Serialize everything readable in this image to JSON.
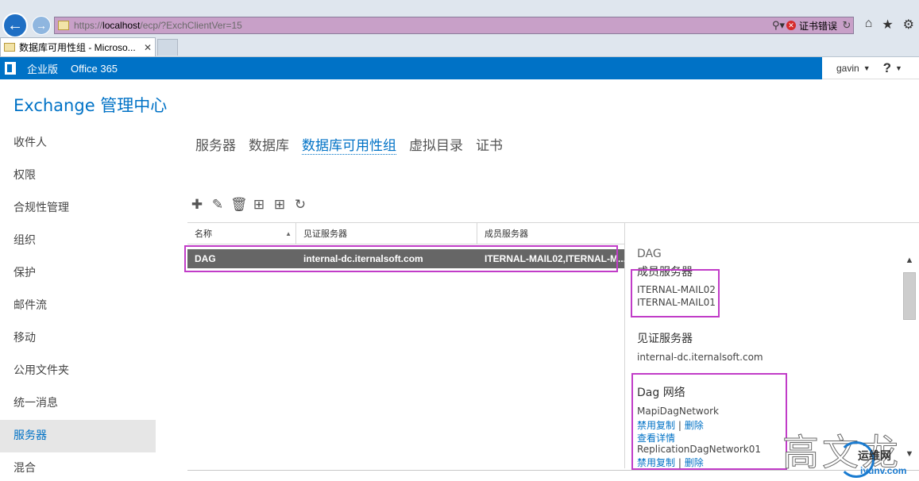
{
  "browser": {
    "url_prefix": "https://",
    "url_host": "localhost",
    "url_path": "/ecp/?ExchClientVer=15",
    "search_icon": "search-icon",
    "cert_error": "证书错误",
    "tab_label": "数据库可用性组 - Microso...",
    "tab_close": "✕"
  },
  "app_bar": {
    "edition": "企业版",
    "office365": "Office 365",
    "user": "gavin",
    "help": "?"
  },
  "page_title": "Exchange 管理中心",
  "nav": {
    "items": [
      "收件人",
      "权限",
      "合规性管理",
      "组织",
      "保护",
      "邮件流",
      "移动",
      "公用文件夹",
      "统一消息",
      "服务器",
      "混合"
    ],
    "active_index": 9
  },
  "sub_tabs": {
    "items": [
      "服务器",
      "数据库",
      "数据库可用性组",
      "虚拟目录",
      "证书"
    ],
    "active_index": 2
  },
  "toolbar": {
    "icons": [
      "add-icon",
      "edit-icon",
      "delete-icon",
      "add-witness-icon",
      "add-network-icon",
      "refresh-icon"
    ]
  },
  "grid": {
    "columns": [
      "名称",
      "见证服务器",
      "成员服务器"
    ],
    "rows": [
      {
        "name": "DAG",
        "witness": "internal-dc.iternalsoft.com",
        "members": "ITERNAL-MAIL02,ITERNAL-M..."
      }
    ]
  },
  "details": {
    "title": "DAG",
    "member_heading": "成员服务器",
    "members": [
      "ITERNAL-MAIL02",
      "ITERNAL-MAIL01"
    ],
    "witness_heading": "见证服务器",
    "witness": "internal-dc.iternalsoft.com",
    "network_heading": "Dag 网络",
    "networks": [
      {
        "name": "MapiDagNetwork",
        "disable": "禁用复制",
        "sep": "|",
        "delete": "删除",
        "details": "查看详情"
      },
      {
        "name": "ReplicationDagNetwork01",
        "disable": "禁用复制",
        "sep": "|",
        "delete": "删除"
      }
    ]
  },
  "watermark": {
    "big": "高文龙",
    "cn": "运维网",
    "url": "iyunv.com"
  },
  "colors": {
    "accent": "#0072c6",
    "highlight": "#c13cc8",
    "selected_row": "#666666"
  }
}
